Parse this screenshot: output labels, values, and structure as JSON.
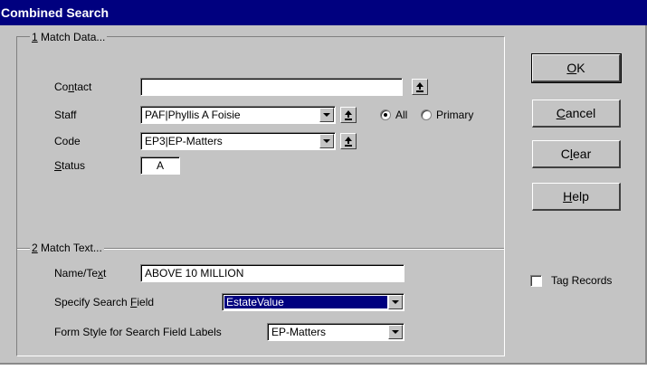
{
  "window": {
    "title": "Combined Search"
  },
  "match_data": {
    "section_number": "1",
    "section_rest": " Match Data...",
    "contact": {
      "label_pre": "Co",
      "label_u": "n",
      "label_post": "tact",
      "value": ""
    },
    "staff": {
      "label": "Staff",
      "value": "PAF|Phyllis A Foisie"
    },
    "staff_scope": {
      "all": "All",
      "primary": "Primary",
      "selected": "all"
    },
    "code": {
      "label": "Code",
      "value": "EP3|EP-Matters"
    },
    "status": {
      "label_u": "S",
      "label_post": "tatus",
      "value": "A"
    }
  },
  "match_text": {
    "section_number": "2",
    "section_rest": " Match Text...",
    "name_text": {
      "label_pre": "Name/Te",
      "label_u": "x",
      "label_post": "t",
      "value": "ABOVE 10 MILLION"
    },
    "search_field": {
      "label_pre": "Specify Search ",
      "label_u": "F",
      "label_post": "ield",
      "value": "EstateValue"
    },
    "form_style": {
      "label": "Form Style for Search Field Labels",
      "value": "EP-Matters"
    }
  },
  "buttons": {
    "ok": {
      "u": "O",
      "rest": "K"
    },
    "cancel": {
      "u": "C",
      "rest": "ancel"
    },
    "clear": {
      "pre": "C",
      "u": "l",
      "rest": "ear"
    },
    "help": {
      "u": "H",
      "rest": "elp"
    }
  },
  "tag_records": {
    "label": "Tag Records",
    "checked": false
  },
  "colors": {
    "titlebar": "#00007f",
    "dialog": "#c4c4c4",
    "selection": "#00007f"
  },
  "icons": {
    "lookup": "upload-arrow-icon",
    "dropdown": "chevron-down-icon"
  }
}
